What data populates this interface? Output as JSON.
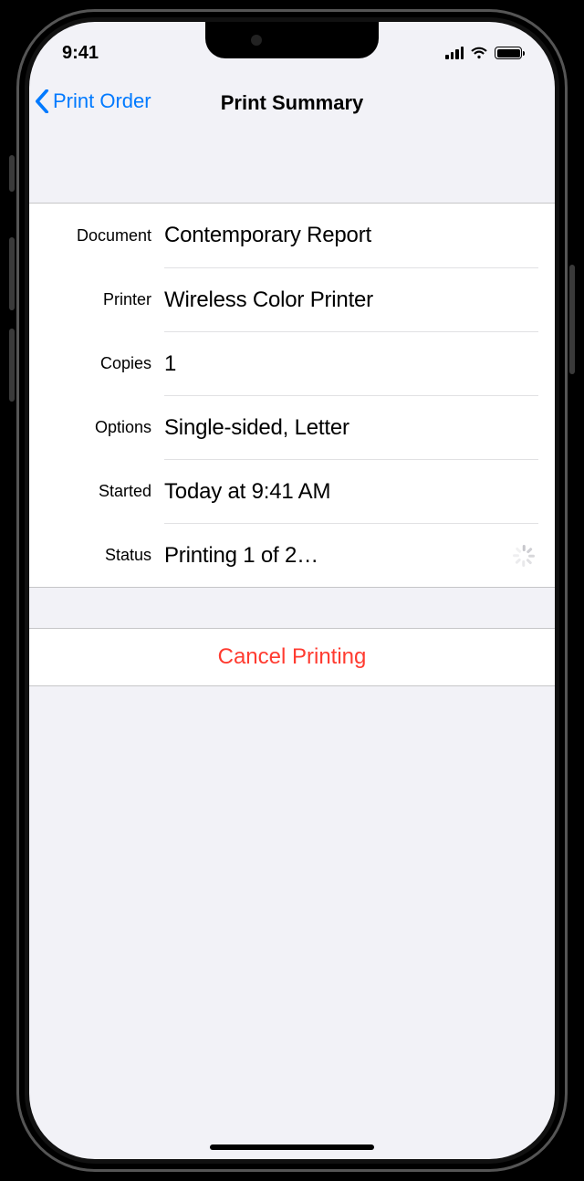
{
  "status_bar": {
    "time": "9:41"
  },
  "nav": {
    "back_label": "Print Order",
    "title": "Print Summary"
  },
  "details": {
    "document_label": "Document",
    "document_value": "Contemporary Report",
    "printer_label": "Printer",
    "printer_value": "Wireless Color Printer",
    "copies_label": "Copies",
    "copies_value": "1",
    "options_label": "Options",
    "options_value": "Single-sided, Letter",
    "started_label": "Started",
    "started_value": "Today at  9:41 AM",
    "status_label": "Status",
    "status_value": "Printing 1 of 2…"
  },
  "actions": {
    "cancel_label": "Cancel Printing"
  }
}
